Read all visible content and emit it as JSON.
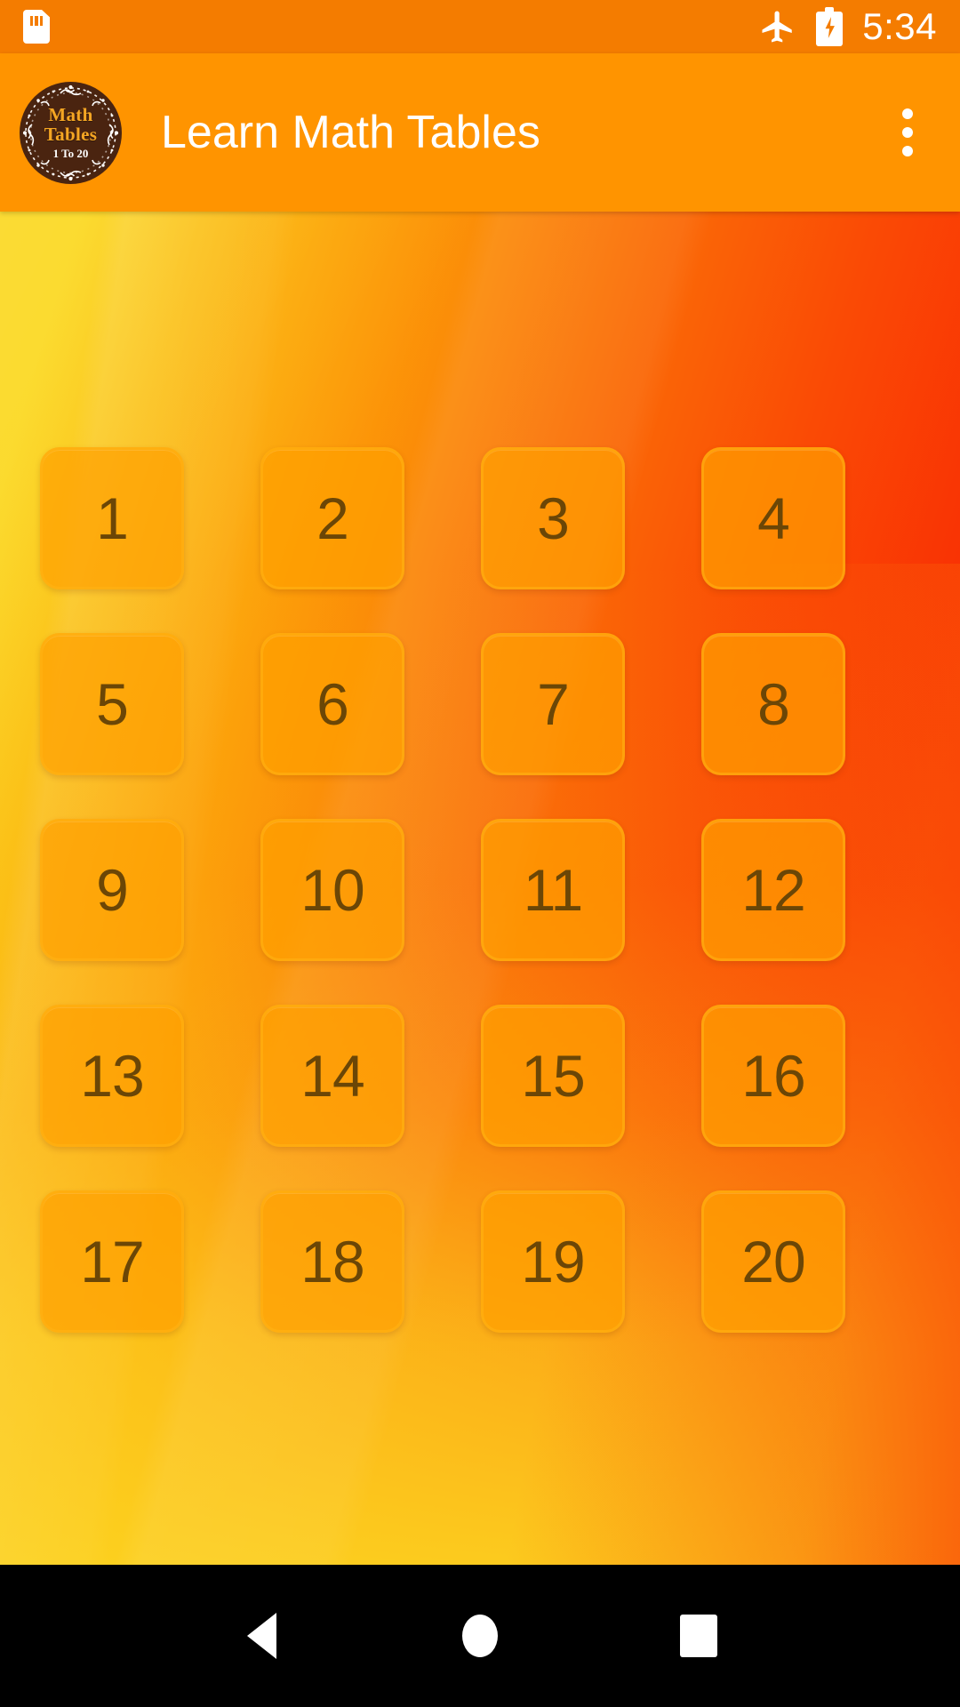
{
  "status_bar": {
    "sim_icon": "sim-card-icon",
    "airplane_icon": "airplane-mode-icon",
    "battery_icon": "battery-charging-icon",
    "time": "5:34",
    "background_color": "#F47C00"
  },
  "app_bar": {
    "background_color": "#FF9400",
    "title": "Learn Math Tables",
    "logo": {
      "name": "math-tables-logo",
      "line1": "Math",
      "line2": "Tables",
      "line3": "1 To 20",
      "badge_color": "#4A2410",
      "text_color": "#F5A623"
    },
    "overflow_menu": {
      "name": "overflow-menu-icon",
      "label": "More options"
    }
  },
  "content": {
    "background": {
      "top_left_color": "#FBD820",
      "top_right_color": "#F61E04",
      "bottom_left_color": "#FCD820",
      "bottom_right_color": "#FA5A06"
    },
    "grid": {
      "columns": 4,
      "rows": 5,
      "button_fill": "#FFA000",
      "button_border": "#FFB214",
      "number_color": "#6B4606",
      "buttons": [
        {
          "label": "1"
        },
        {
          "label": "2"
        },
        {
          "label": "3"
        },
        {
          "label": "4"
        },
        {
          "label": "5"
        },
        {
          "label": "6"
        },
        {
          "label": "7"
        },
        {
          "label": "8"
        },
        {
          "label": "9"
        },
        {
          "label": "10"
        },
        {
          "label": "11"
        },
        {
          "label": "12"
        },
        {
          "label": "13"
        },
        {
          "label": "14"
        },
        {
          "label": "15"
        },
        {
          "label": "16"
        },
        {
          "label": "17"
        },
        {
          "label": "18"
        },
        {
          "label": "19"
        },
        {
          "label": "20"
        }
      ]
    }
  },
  "nav_bar": {
    "background_color": "#000000",
    "back": "back-nav-icon",
    "home": "home-nav-icon",
    "recents": "recents-nav-icon"
  }
}
